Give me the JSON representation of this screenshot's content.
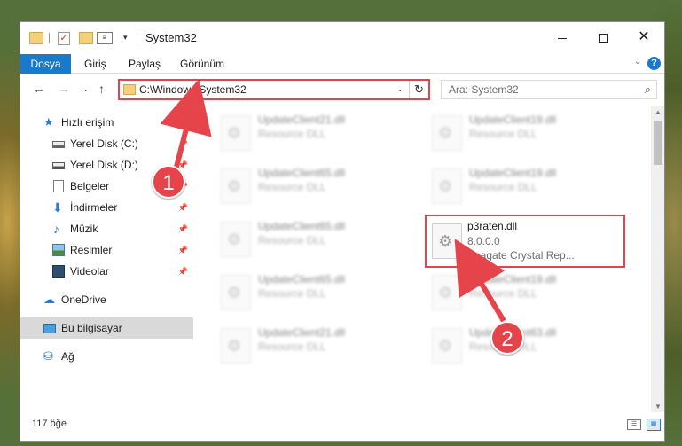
{
  "window": {
    "title": "System32",
    "controls": {
      "minimize": "",
      "maximize": "",
      "close": "✕"
    }
  },
  "quick_access_toolbar": {
    "dropdown_glyph": "▾",
    "check_glyph": "✓",
    "props_glyph": "≡"
  },
  "ribbon": {
    "tabs": [
      {
        "label": "Dosya",
        "active": true
      },
      {
        "label": "Giriş"
      },
      {
        "label": "Paylaş"
      },
      {
        "label": "Görünüm"
      }
    ],
    "expand_glyph": "⌄",
    "help_glyph": "?"
  },
  "navigation": {
    "back_glyph": "←",
    "forward_glyph": "→",
    "recent_glyph": "⌄",
    "up_glyph": "↑",
    "address": "C:\\Windows\\System32",
    "address_dropdown_glyph": "⌄",
    "refresh_glyph": "↻",
    "search_placeholder": "Ara: System32",
    "search_glyph": "⌕"
  },
  "sidebar": {
    "items": [
      {
        "label": "Hızlı erişim",
        "icon": "star-icon",
        "glyph": "★",
        "pinned": false
      },
      {
        "label": "Yerel Disk (C:)",
        "icon": "drive-icon",
        "pinned": true
      },
      {
        "label": "Yerel Disk (D:)",
        "icon": "drive-icon",
        "pinned": true
      },
      {
        "label": "Belgeler",
        "icon": "document-icon",
        "pinned": true
      },
      {
        "label": "İndirmeler",
        "icon": "download-icon",
        "glyph": "⬇",
        "pinned": true
      },
      {
        "label": "Müzik",
        "icon": "music-icon",
        "glyph": "♪",
        "pinned": true
      },
      {
        "label": "Resimler",
        "icon": "pictures-icon",
        "pinned": true
      },
      {
        "label": "Videolar",
        "icon": "video-icon",
        "pinned": true
      },
      {
        "label": "OneDrive",
        "icon": "cloud-icon",
        "glyph": "☁"
      },
      {
        "label": "Bu bilgisayar",
        "icon": "computer-icon",
        "selected": true
      },
      {
        "label": "Ağ",
        "icon": "network-icon",
        "glyph": "⛁"
      }
    ],
    "pin_glyph": "📌"
  },
  "files": [
    {
      "name": "UpdateClient21.dll",
      "type": "Resource DLL",
      "version": ""
    },
    {
      "name": "UpdateClient19.dll",
      "type": "Resource DLL",
      "version": ""
    },
    {
      "name": "UpdateClient65.dll",
      "type": "Resource DLL",
      "version": ""
    },
    {
      "name": "UpdateClient19.dll",
      "type": "Resource DLL",
      "version": ""
    },
    {
      "name": "UpdateClient65.dll",
      "type": "Resource DLL",
      "version": ""
    },
    {
      "name": "p3raten.dll",
      "type": "Seagate Crystal Rep...",
      "version": "8.0.0.0",
      "highlighted": true
    },
    {
      "name": "UpdateClient65.dll",
      "type": "Resource DLL",
      "version": ""
    },
    {
      "name": "UpdateClient19.dll",
      "type": "Resource DLL",
      "version": ""
    },
    {
      "name": "UpdateClient21.dll",
      "type": "Resource DLL",
      "version": ""
    },
    {
      "name": "UpdateClient63.dll",
      "type": "Resource DLL",
      "version": ""
    }
  ],
  "file_icon_glyph": "⚙",
  "status": {
    "item_count": "117 öğe"
  },
  "annotations": {
    "callout_1": "1",
    "callout_2": "2"
  },
  "colors": {
    "accent": "#1979ca",
    "annotation_red": "#e5454a",
    "selected_bg": "#d9d9d9"
  }
}
